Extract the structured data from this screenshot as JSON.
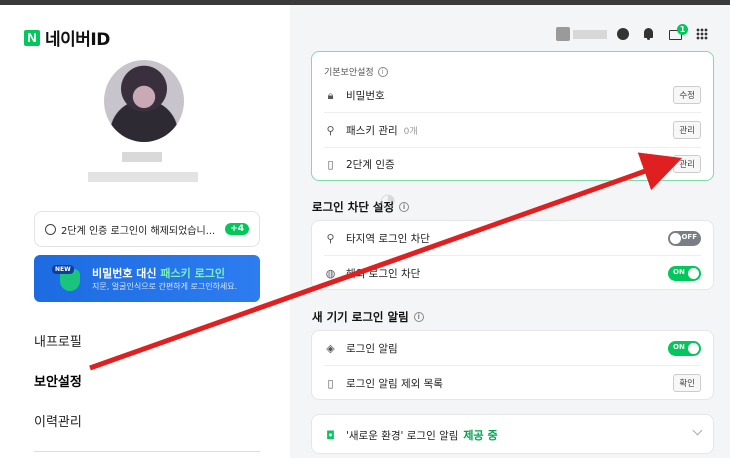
{
  "brand": {
    "logo_letter": "N",
    "logo_text": "네이버ID",
    "accent": "#03c75a"
  },
  "notice": {
    "text": "2단계 인증 로그인이 해제되었습니...",
    "badge": "+4"
  },
  "banner": {
    "new_tag": "NEW",
    "title_prefix": "비밀번호 대신 ",
    "title_highlight": "패스키 로그인",
    "subtitle": "지문, 얼굴인식으로 간편하게 로그인하세요."
  },
  "nav": {
    "items": [
      {
        "label": "내프로필",
        "active": false
      },
      {
        "label": "보안설정",
        "active": true
      },
      {
        "label": "이력관리",
        "active": false
      }
    ]
  },
  "header": {
    "mail_count": "1"
  },
  "basic_security": {
    "title": "기본보안설정",
    "rows": [
      {
        "label": "비밀번호",
        "sub": "",
        "button": "수정",
        "icon": "lock-icon"
      },
      {
        "label": "패스키 관리",
        "sub": "0개",
        "button": "관리",
        "icon": "passkey-icon"
      },
      {
        "label": "2단계 인증",
        "sub": "",
        "button": "관리",
        "icon": "phone-icon"
      }
    ]
  },
  "login_block": {
    "title": "로그인 차단 설정",
    "rows": [
      {
        "label": "타지역 로그인 차단",
        "toggle": "OFF",
        "icon": "location-icon"
      },
      {
        "label": "해외 로그인 차단",
        "toggle": "ON",
        "icon": "globe-icon"
      }
    ]
  },
  "new_device": {
    "title": "새 기기 로그인 알림",
    "rows": [
      {
        "label": "로그인 알림",
        "toggle": "ON",
        "icon": "shield-bell-icon"
      },
      {
        "label": "로그인 알림 제외 목록",
        "button": "확인",
        "icon": "device-icon"
      }
    ]
  },
  "new_env": {
    "label": "'새로운 환경' 로그인 알림",
    "status": "제공 중"
  },
  "annotation": {
    "arrow_color": "#e02020"
  }
}
